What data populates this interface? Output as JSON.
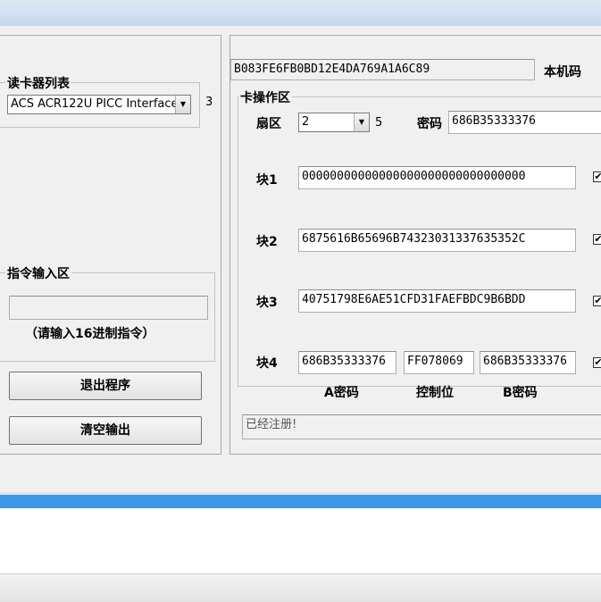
{
  "reader_group": {
    "title": "读卡器列表",
    "selected": "ACS ACR122U PICC Interface",
    "count": "3"
  },
  "command_group": {
    "title": "指令输入区",
    "input_value": "",
    "hint": "（请输入16进制指令）"
  },
  "buttons": {
    "exit": "退出程序",
    "clear": "清空输出"
  },
  "machine_code": {
    "value": "B083FE6FB0BD12E4DA769A1A6C89",
    "label": "本机码"
  },
  "card_group": {
    "title": "卡操作区",
    "sector_label": "扇区",
    "sector_value": "2",
    "sector_count": "5",
    "password_label": "密码",
    "password_value": "686B35333376",
    "blocks": [
      {
        "label": "块1",
        "value": "00000000000000000000000000000000",
        "checked": "✔"
      },
      {
        "label": "块2",
        "value": "6875616B65696B74323031337635352C",
        "checked": "✔"
      },
      {
        "label": "块3",
        "value": "40751798E6AE51CFD31FAEFBDC9B6BDD",
        "checked": "✔"
      },
      {
        "label": "块4",
        "checked": "✔"
      }
    ],
    "block4": {
      "key_a": "686B35333376",
      "control": "FF078069",
      "key_b": "686B35333376",
      "key_a_label": "A密码",
      "control_label": "控制位",
      "key_b_label": "B密码"
    }
  },
  "status": {
    "text": "已经注册!"
  }
}
